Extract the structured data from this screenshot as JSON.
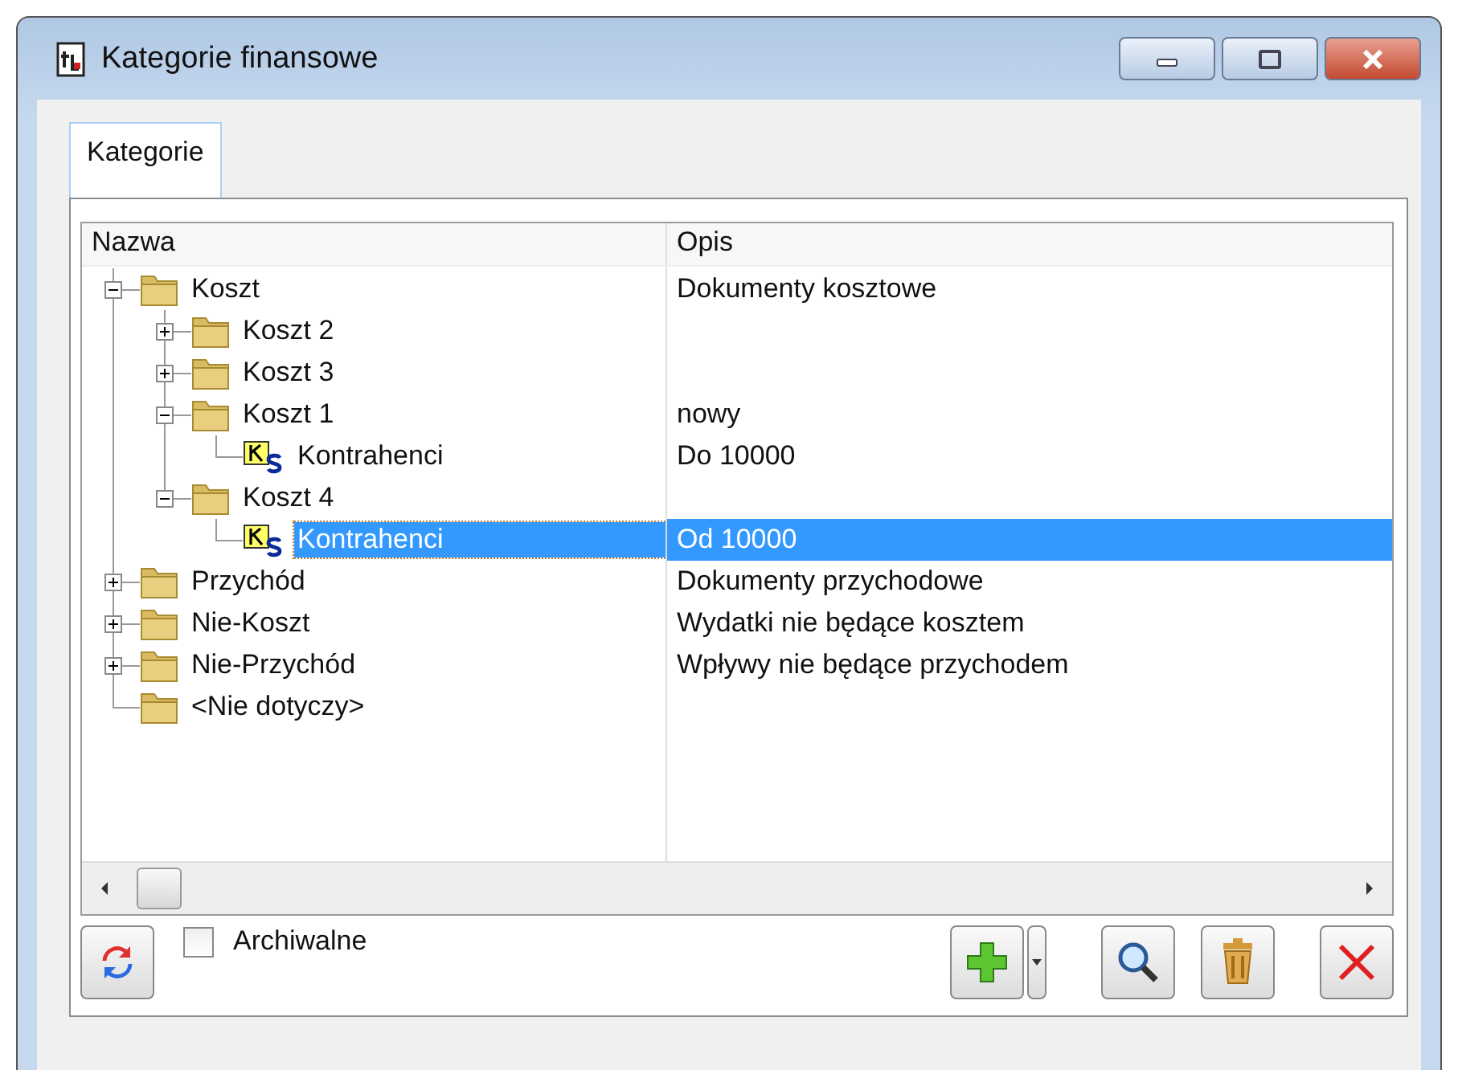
{
  "window": {
    "title": "Kategorie finansowe"
  },
  "tabs": [
    {
      "label": "Kategorie",
      "selected": true
    }
  ],
  "tree": {
    "columns": [
      "Nazwa",
      "Opis"
    ],
    "items": [
      {
        "kind": "folder",
        "name": "Koszt",
        "description": "Dokumenty kosztowe",
        "expanded": true,
        "selected": false,
        "children": [
          {
            "kind": "folder",
            "name": "Koszt 2",
            "expanded": false,
            "selected": false
          },
          {
            "kind": "folder",
            "name": "Koszt 3",
            "expanded": false,
            "selected": false
          },
          {
            "kind": "folder",
            "name": "Koszt 1",
            "description": "nowy",
            "expanded": true,
            "selected": false,
            "children": [
              {
                "kind": "contractor",
                "name": "Kontrahenci",
                "description": "Do 10000",
                "selected": false
              }
            ]
          },
          {
            "kind": "folder",
            "name": "Koszt 4",
            "expanded": true,
            "selected": false,
            "children": [
              {
                "kind": "contractor",
                "name": "Kontrahenci",
                "description": "Od 10000",
                "selected": true
              }
            ]
          }
        ]
      },
      {
        "kind": "folder",
        "name": "Przychód",
        "description": "Dokumenty przychodowe",
        "expanded": false,
        "selected": false
      },
      {
        "kind": "folder",
        "name": "Nie-Koszt",
        "description": "Wydatki nie będące kosztem",
        "expanded": false,
        "selected": false
      },
      {
        "kind": "folder",
        "name": "Nie-Przychód",
        "description": "Wpływy nie będące przychodem",
        "expanded": false,
        "selected": false
      },
      {
        "kind": "folder",
        "name": "<Nie dotyczy>",
        "selected": false
      }
    ]
  },
  "archive_checkbox": {
    "label": "Archiwalne",
    "checked": false
  }
}
